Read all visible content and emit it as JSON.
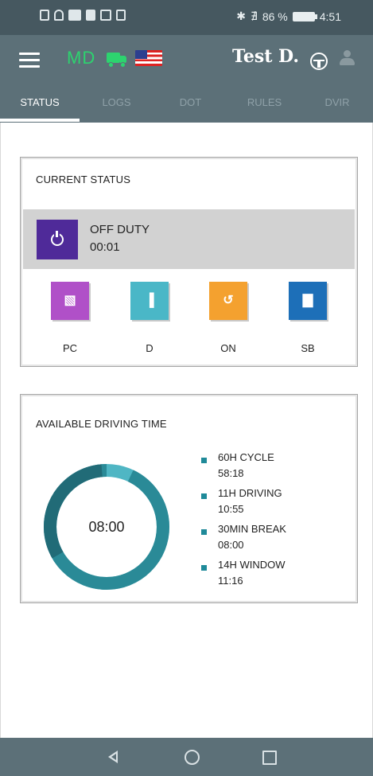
{
  "status_bar": {
    "battery": "86 %",
    "time": "4:51",
    "icons": [
      "sim-icon",
      "wifi-icon",
      "cast-icon",
      "notification-icon",
      "mail-icon",
      "screenshot-icon",
      "bluetooth-icon",
      "mute-icon",
      "battery-icon"
    ]
  },
  "header": {
    "md_label": "MD",
    "user_name": "Test D.",
    "icons": [
      "menu-icon",
      "truck-icon",
      "us-flag-icon",
      "steering-wheel-icon",
      "person-icon"
    ]
  },
  "tabs": [
    {
      "label": "STATUS",
      "active": true
    },
    {
      "label": "LOGS"
    },
    {
      "label": "DOT"
    },
    {
      "label": "RULES"
    },
    {
      "label": "DVIR"
    }
  ],
  "current_status": {
    "title": "CURRENT STATUS",
    "status_name": "OFF DUTY",
    "status_time": "00:01",
    "status_color": "#4f2a99",
    "buttons": [
      {
        "label": "PC",
        "color": "#b050c8",
        "icon": "map-icon"
      },
      {
        "label": "D",
        "color": "#4ab7c7",
        "icon": "road-icon"
      },
      {
        "label": "ON",
        "color": "#f4a12f",
        "icon": "history-icon"
      },
      {
        "label": "SB",
        "color": "#1d6fb8",
        "icon": "bed-icon"
      }
    ]
  },
  "driving_time": {
    "title": "AVAILABLE DRIVING TIME",
    "center_value": "08:00",
    "donut_fraction": 0.93,
    "colors": {
      "main": "#2a8a97",
      "dark": "#1e5e69",
      "accent": "#4fb6c4"
    },
    "items": [
      {
        "label": "60H CYCLE",
        "value": "58:18"
      },
      {
        "label": "11H DRIVING",
        "value": "10:55"
      },
      {
        "label": "30MIN BREAK",
        "value": "08:00"
      },
      {
        "label": "14H WINDOW",
        "value": "11:16"
      }
    ]
  },
  "nav_bar": {
    "icons": [
      "back-icon",
      "home-icon",
      "recent-apps-icon"
    ]
  }
}
